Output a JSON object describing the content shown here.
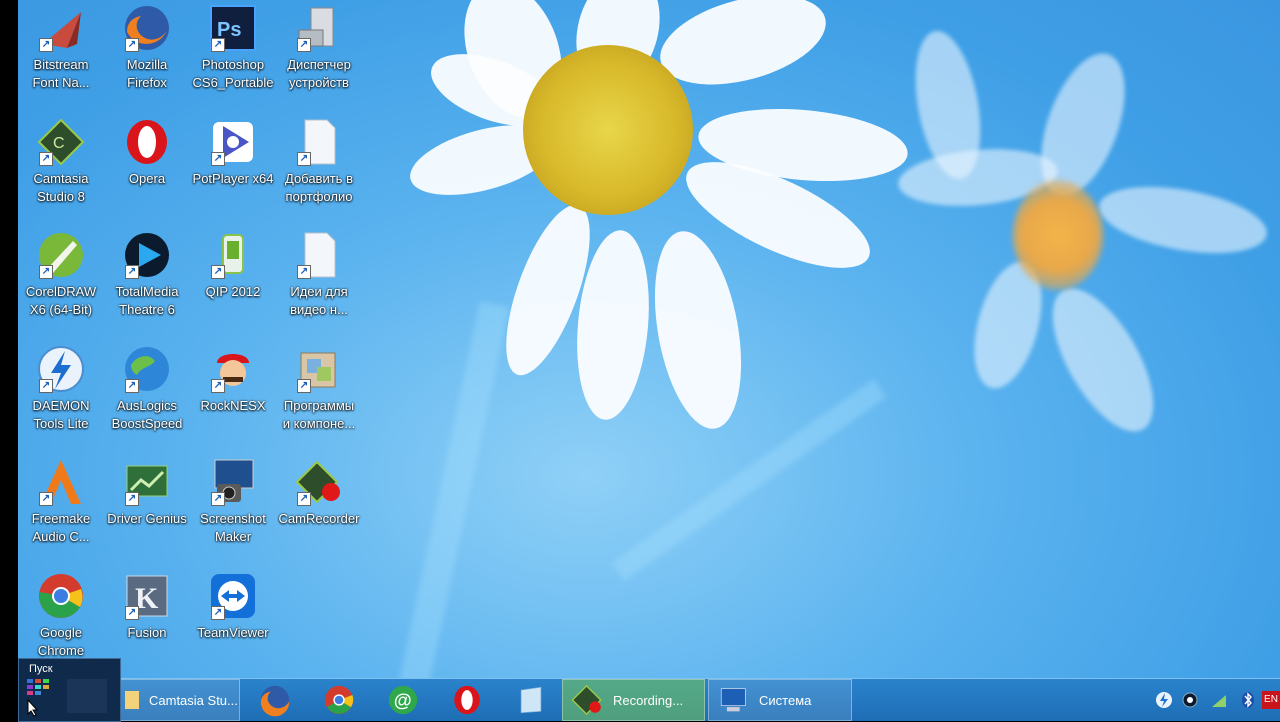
{
  "desktop_icons": [
    {
      "name": "bitstream-font-navigator",
      "label": "Bitstream\nFont Na...",
      "icon": "font-navigator-icon"
    },
    {
      "name": "mozilla-firefox",
      "label": "Mozilla\nFirefox",
      "icon": "firefox-icon"
    },
    {
      "name": "photoshop-cs6",
      "label": "Photoshop\nCS6_Portable",
      "icon": "photoshop-icon"
    },
    {
      "name": "device-manager",
      "label": "Диспетчер\nустройств",
      "icon": "device-manager-icon"
    },
    {
      "name": "camtasia-studio-8",
      "label": "Camtasia\nStudio 8",
      "icon": "camtasia-icon"
    },
    {
      "name": "opera",
      "label": "Opera",
      "icon": "opera-icon"
    },
    {
      "name": "potplayer",
      "label": "PotPlayer x64",
      "icon": "potplayer-icon"
    },
    {
      "name": "add-to-portfolio",
      "label": "Добавить в\nпортфолио",
      "icon": "file-icon"
    },
    {
      "name": "coreldraw",
      "label": "CorelDRAW\nX6 (64-Bit)",
      "icon": "coreldraw-icon"
    },
    {
      "name": "totalmedia-theatre",
      "label": "TotalMedia\nTheatre 6",
      "icon": "totalmedia-icon"
    },
    {
      "name": "qip-2012",
      "label": "QIP 2012",
      "icon": "qip-icon"
    },
    {
      "name": "video-ideas",
      "label": "Идеи для\nвидео н...",
      "icon": "file-icon"
    },
    {
      "name": "daemon-tools",
      "label": "DAEMON\nTools Lite",
      "icon": "daemon-tools-icon"
    },
    {
      "name": "auslogics",
      "label": "AusLogics\nBoostSpeed",
      "icon": "auslogics-icon"
    },
    {
      "name": "rocknesx",
      "label": "RockNESX",
      "icon": "mario-icon"
    },
    {
      "name": "programs-components",
      "label": "Программы\nи компоне...",
      "icon": "programs-icon"
    },
    {
      "name": "freemake-audio",
      "label": "Freemake\nAudio C...",
      "icon": "freemake-icon"
    },
    {
      "name": "driver-genius",
      "label": "Driver Genius",
      "icon": "driver-genius-icon"
    },
    {
      "name": "screenshot-maker",
      "label": "Screenshot\nMaker",
      "icon": "screenshot-maker-icon"
    },
    {
      "name": "camrecorder",
      "label": "CamRecorder",
      "icon": "camrecorder-icon"
    },
    {
      "name": "google-chrome",
      "label": "Google\nChrome",
      "icon": "chrome-icon"
    },
    {
      "name": "fusion",
      "label": "Fusion",
      "icon": "fusion-icon"
    },
    {
      "name": "teamviewer",
      "label": "TeamViewer",
      "icon": "teamviewer-icon"
    }
  ],
  "start_popup": {
    "label": "Пуск"
  },
  "taskbar": {
    "items": [
      {
        "label": "Camtasia Stu...",
        "icon": "folder-icon"
      },
      {
        "label": "",
        "icon": "firefox-icon"
      },
      {
        "label": "",
        "icon": "chrome-icon"
      },
      {
        "label": "",
        "icon": "mail-agent-icon"
      },
      {
        "label": "",
        "icon": "opera-icon"
      },
      {
        "label": "",
        "icon": "glass-app-icon"
      },
      {
        "label": "Recording...",
        "icon": "camtasia-recorder-icon"
      },
      {
        "label": "Система",
        "icon": "system-icon"
      }
    ],
    "tray": [
      "daemon-tray-icon",
      "media-tray-icon",
      "network-tray-icon",
      "bluetooth-icon",
      "language-icon"
    ],
    "lang": "EN"
  }
}
